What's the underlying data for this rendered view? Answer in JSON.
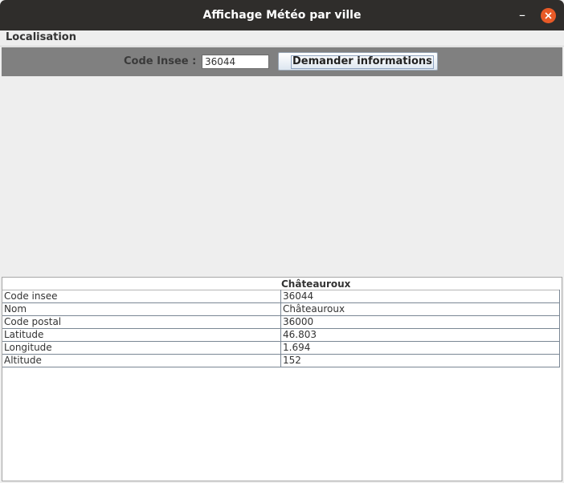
{
  "window": {
    "title": "Affichage Météo par ville",
    "minimize_symbol": "–",
    "close_icon": "close-icon",
    "close_color": "#e85a27"
  },
  "menubar": {
    "items": [
      {
        "label": "Localisation"
      }
    ]
  },
  "toolbar": {
    "code_label": "Code Insee :",
    "code_value": "36044",
    "button_label": "Demander informations",
    "background": "#808080"
  },
  "table": {
    "column_header": "Châteauroux",
    "rows": [
      {
        "key": "Code insee",
        "value": "36044"
      },
      {
        "key": "Nom",
        "value": "Châteauroux"
      },
      {
        "key": "Code postal",
        "value": "36000"
      },
      {
        "key": "Latitude",
        "value": "46.803"
      },
      {
        "key": "Longitude",
        "value": "1.694"
      },
      {
        "key": "Altitude",
        "value": "152"
      }
    ]
  }
}
